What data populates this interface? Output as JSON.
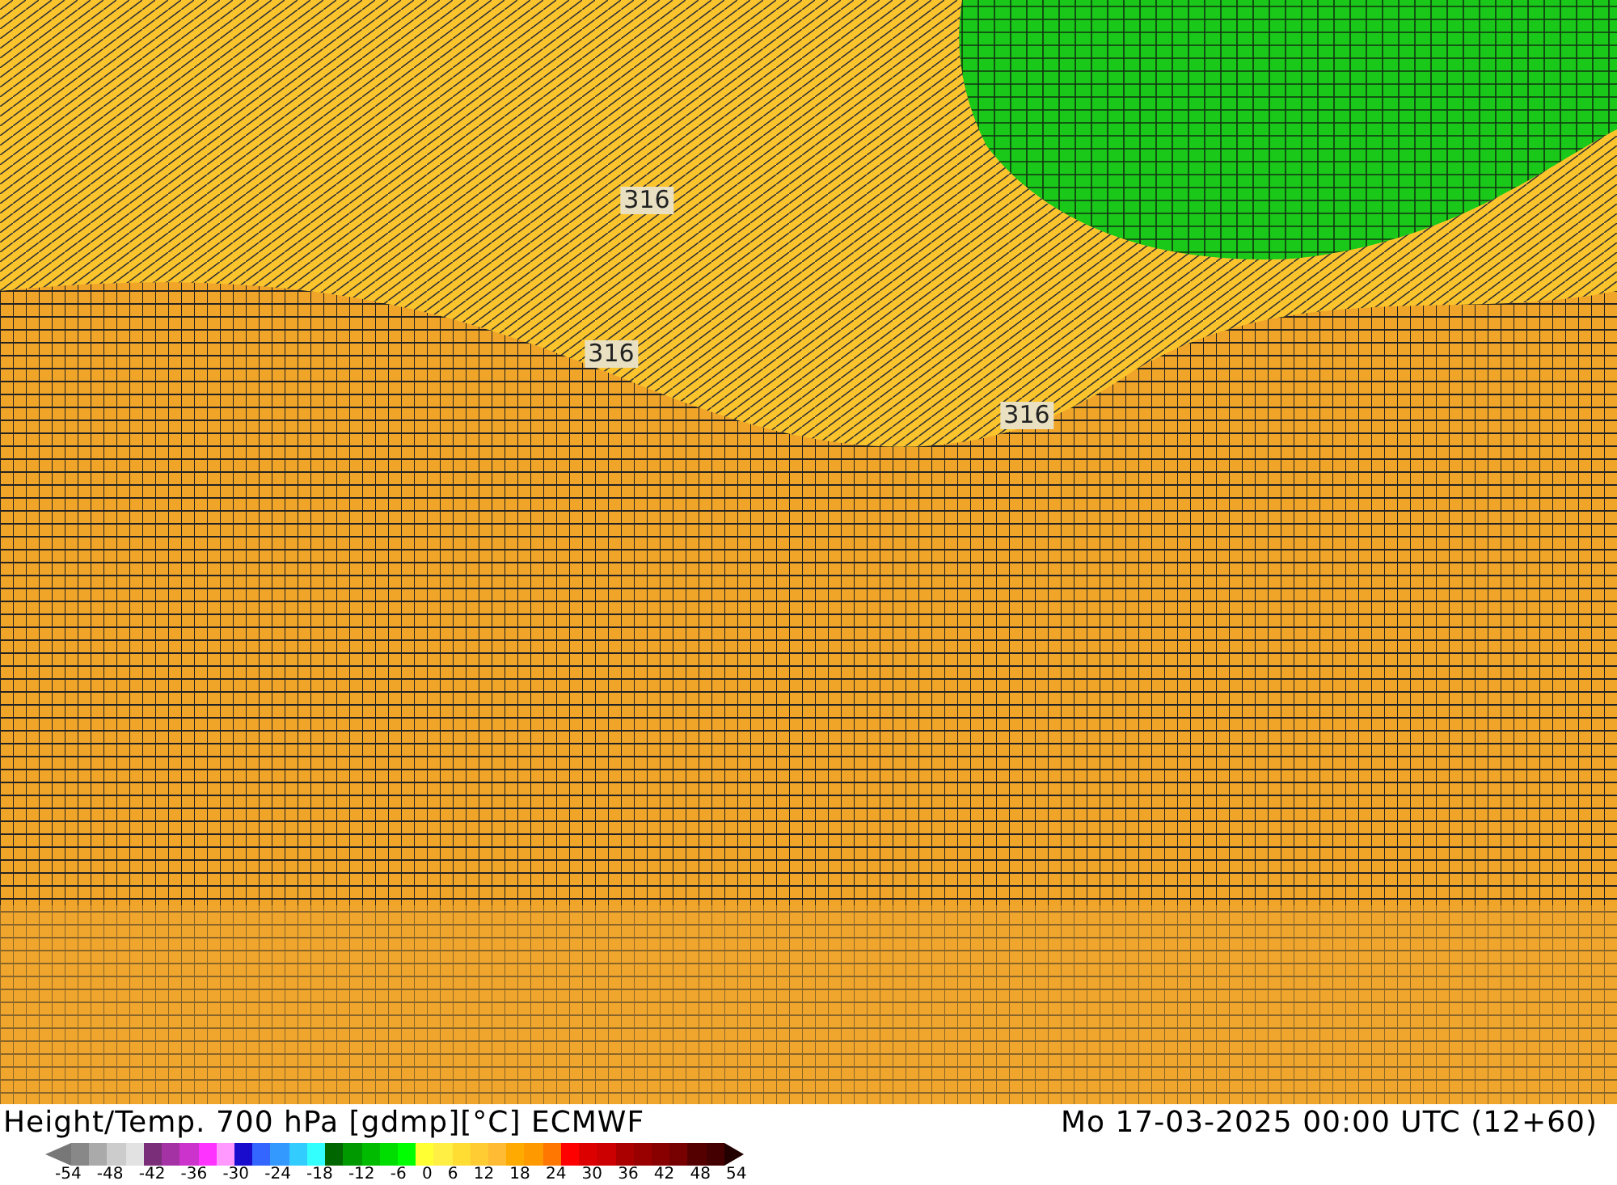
{
  "map": {
    "contour_labels": [
      {
        "text": "316"
      },
      {
        "text": "316"
      },
      {
        "text": "316"
      }
    ]
  },
  "footer": {
    "title": "Height/Temp. 700 hPa [gdmp][°C] ECMWF",
    "run": "Mo 17-03-2025 00:00 UTC (12+60)"
  },
  "legend": {
    "swatches": [
      {
        "color": "#888888"
      },
      {
        "color": "#aaaaaa"
      },
      {
        "color": "#cccccc"
      },
      {
        "color": "#e2e2e2"
      },
      {
        "color": "#7a2e7a"
      },
      {
        "color": "#a532a5"
      },
      {
        "color": "#cc33cc"
      },
      {
        "color": "#ff33ff"
      },
      {
        "color": "#ff99ff"
      },
      {
        "color": "#1a0ccc"
      },
      {
        "color": "#3366ff"
      },
      {
        "color": "#3399ff"
      },
      {
        "color": "#33ccff"
      },
      {
        "color": "#33ffff"
      },
      {
        "color": "#006600"
      },
      {
        "color": "#009900"
      },
      {
        "color": "#00bb00"
      },
      {
        "color": "#00dd00"
      },
      {
        "color": "#00ff00"
      },
      {
        "color": "#ffff33"
      },
      {
        "color": "#ffee44"
      },
      {
        "color": "#ffdd33"
      },
      {
        "color": "#ffcc33"
      },
      {
        "color": "#ffbb33"
      },
      {
        "color": "#ffaa00"
      },
      {
        "color": "#ff9900"
      },
      {
        "color": "#ff7700"
      },
      {
        "color": "#ff0000"
      },
      {
        "color": "#dd0000"
      },
      {
        "color": "#cc0000"
      },
      {
        "color": "#aa0000"
      },
      {
        "color": "#990000"
      },
      {
        "color": "#880000"
      },
      {
        "color": "#770000"
      },
      {
        "color": "#550000"
      },
      {
        "color": "#440000"
      }
    ],
    "ticks": [
      "-54",
      "-48",
      "-42",
      "-36",
      "-30",
      "-24",
      "-18",
      "-12",
      "-6",
      "0",
      "6",
      "12",
      "18",
      "24",
      "30",
      "36",
      "42",
      "48",
      "54"
    ]
  }
}
